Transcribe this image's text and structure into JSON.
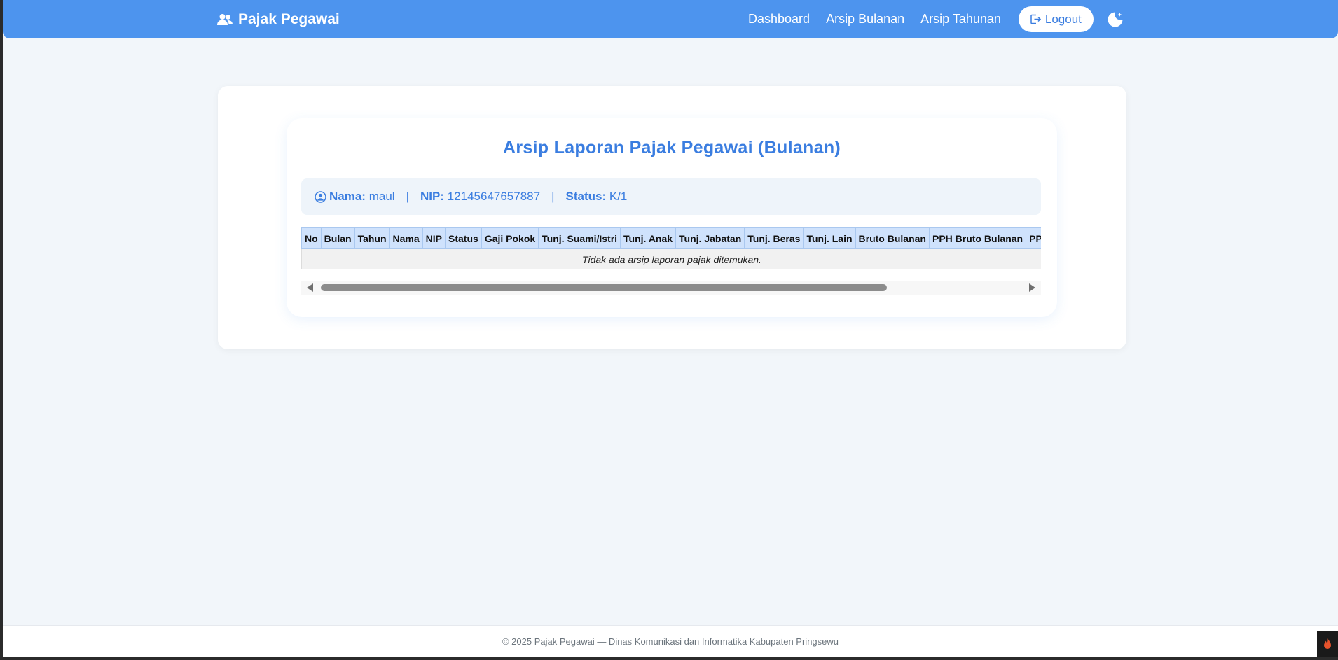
{
  "navbar": {
    "brand": "Pajak Pegawai",
    "links": [
      {
        "label": "Dashboard"
      },
      {
        "label": "Arsip Bulanan"
      },
      {
        "label": "Arsip Tahunan"
      }
    ],
    "logout_label": "Logout",
    "theme_toggle_icon": "moon-icon"
  },
  "main": {
    "title": "Arsip Laporan Pajak Pegawai (Bulanan)",
    "info": {
      "nama_label": "Nama:",
      "nama_value": "maul",
      "nip_label": "NIP:",
      "nip_value": "12145647657887",
      "status_label": "Status:",
      "status_value": "K/1",
      "separator": "|"
    },
    "table": {
      "headers": [
        "No",
        "Bulan",
        "Tahun",
        "Nama",
        "NIP",
        "Status",
        "Gaji Pokok",
        "Tunj. Suami/Istri",
        "Tunj. Anak",
        "Tunj. Jabatan",
        "Tunj. Beras",
        "Tunj. Lain",
        "Bruto Bulanan",
        "PPH Bruto Bulanan",
        "PPH Bruto Tahunan"
      ],
      "empty_message": "Tidak ada arsip laporan pajak ditemukan."
    }
  },
  "footer": {
    "text": "© 2025 Pajak Pegawai — Dinas Komunikasi dan Informatika Kabupaten Pringsewu"
  },
  "colors": {
    "primary": "#4d94ee",
    "accent_text": "#3a7de0",
    "table_header": "#cfe2fc",
    "background": "#f2f6fa"
  }
}
